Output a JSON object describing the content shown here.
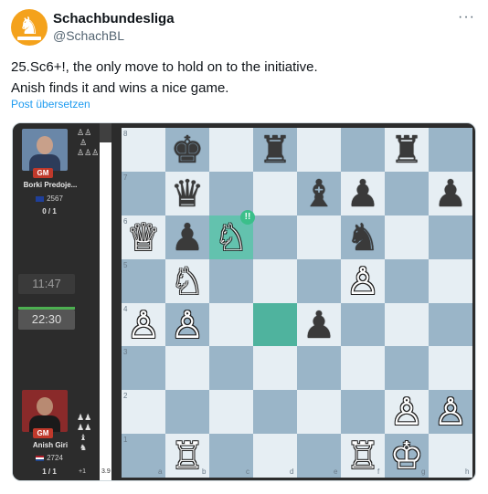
{
  "account": {
    "display_name": "Schachbundesliga",
    "handle": "@SchachBL",
    "more_label": "···"
  },
  "tweet": {
    "line1": "25.Sc6+!, the only move to hold on to the initiative.",
    "line2": "Anish finds it and wins a nice game.",
    "translate_label": "Post übersetzen"
  },
  "top_player": {
    "title": "GM",
    "name": "Borki Predoje...",
    "rating": "2567",
    "score": "0 / 1",
    "clock": "11:47"
  },
  "bottom_player": {
    "title": "GM",
    "name": "Anish Giri",
    "rating": "2724",
    "score": "1 / 1",
    "clock": "22:30",
    "material": "+1"
  },
  "eval": "3.9",
  "board": {
    "ranks": [
      "8",
      "7",
      "6",
      "5",
      "4",
      "3",
      "2",
      "1"
    ],
    "files": [
      "a",
      "b",
      "c",
      "d",
      "e",
      "f",
      "g",
      "h"
    ],
    "annotation": "!!",
    "pieces": [
      {
        "sq": "b8",
        "g": "♚",
        "c": "b"
      },
      {
        "sq": "d8",
        "g": "♜",
        "c": "b"
      },
      {
        "sq": "g8",
        "g": "♜",
        "c": "b"
      },
      {
        "sq": "b7",
        "g": "♛",
        "c": "b"
      },
      {
        "sq": "e7",
        "g": "♝",
        "c": "b"
      },
      {
        "sq": "f7",
        "g": "♟",
        "c": "b"
      },
      {
        "sq": "h7",
        "g": "♟",
        "c": "b"
      },
      {
        "sq": "a6",
        "g": "♕",
        "c": "w"
      },
      {
        "sq": "b6",
        "g": "♟",
        "c": "b"
      },
      {
        "sq": "c6",
        "g": "♘",
        "c": "w"
      },
      {
        "sq": "f6",
        "g": "♞",
        "c": "b"
      },
      {
        "sq": "b5",
        "g": "♘",
        "c": "w"
      },
      {
        "sq": "f5",
        "g": "♙",
        "c": "w"
      },
      {
        "sq": "a4",
        "g": "♙",
        "c": "w"
      },
      {
        "sq": "b4",
        "g": "♙",
        "c": "w"
      },
      {
        "sq": "e4",
        "g": "♟",
        "c": "b"
      },
      {
        "sq": "g2",
        "g": "♙",
        "c": "w"
      },
      {
        "sq": "h2",
        "g": "♙",
        "c": "w"
      },
      {
        "sq": "b1",
        "g": "♖",
        "c": "w"
      },
      {
        "sq": "f1",
        "g": "♖",
        "c": "w"
      },
      {
        "sq": "g1",
        "g": "♔",
        "c": "w"
      }
    ],
    "highlights": [
      "c6",
      "d4"
    ]
  }
}
